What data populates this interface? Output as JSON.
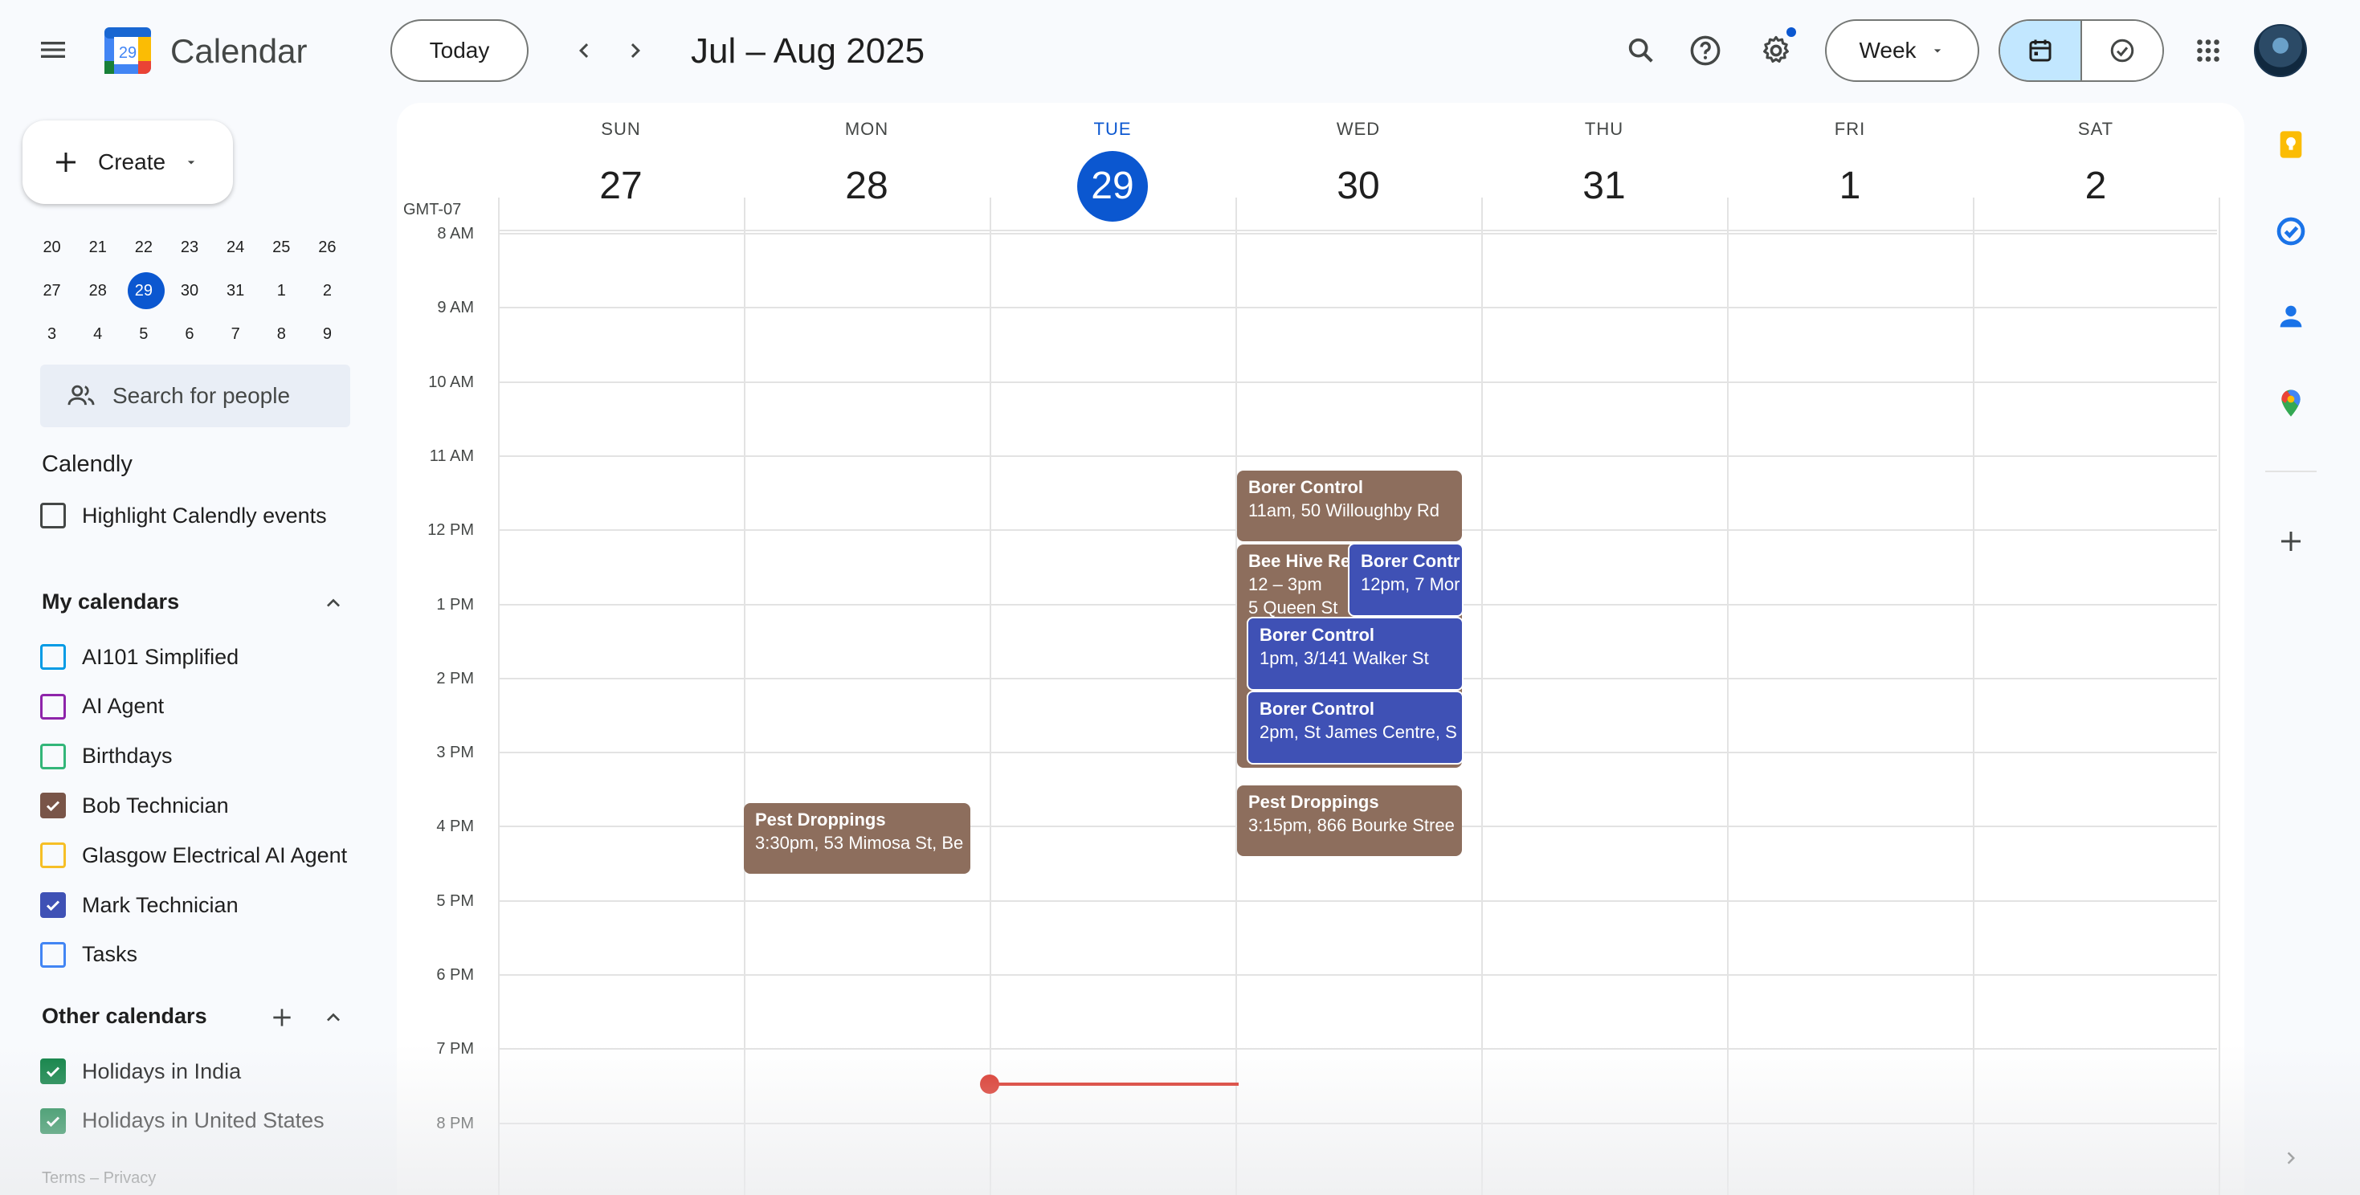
{
  "header": {
    "app_title": "Calendar",
    "logo_day": "29",
    "today_label": "Today",
    "range_title": "Jul – Aug 2025",
    "view_label": "Week"
  },
  "sidebar": {
    "create_label": "Create",
    "mini_calendar": {
      "rows": [
        [
          "20",
          "21",
          "22",
          "23",
          "24",
          "25",
          "26"
        ],
        [
          "27",
          "28",
          "29",
          "30",
          "31",
          "1",
          "2"
        ],
        [
          "3",
          "4",
          "5",
          "6",
          "7",
          "8",
          "9"
        ]
      ],
      "today": "29"
    },
    "people_search_placeholder": "Search for people",
    "calendly": {
      "title": "Calendly",
      "highlight_label": "Highlight Calendly events"
    },
    "my_calendars": {
      "title": "My calendars",
      "items": [
        {
          "label": "AI101 Simplified",
          "color": "#039be5",
          "checked": false
        },
        {
          "label": "AI Agent",
          "color": "#8e24aa",
          "checked": false
        },
        {
          "label": "Birthdays",
          "color": "#33b679",
          "checked": false
        },
        {
          "label": "Bob Technician",
          "color": "#795548",
          "checked": true
        },
        {
          "label": "Glasgow Electrical AI Agent",
          "color": "#f6bf26",
          "checked": false
        },
        {
          "label": "Mark Technician",
          "color": "#3f51b5",
          "checked": true
        },
        {
          "label": "Tasks",
          "color": "#4285f4",
          "checked": false
        }
      ]
    },
    "other_calendars": {
      "title": "Other calendars",
      "items": [
        {
          "label": "Holidays in India",
          "color": "#0b8043",
          "checked": true
        },
        {
          "label": "Holidays in United States",
          "color": "#0b8043",
          "checked": true
        }
      ]
    },
    "footer": "Terms – Privacy"
  },
  "week": {
    "timezone": "GMT-07",
    "days": [
      {
        "name": "SUN",
        "num": "27",
        "today": false
      },
      {
        "name": "MON",
        "num": "28",
        "today": false
      },
      {
        "name": "TUE",
        "num": "29",
        "today": true
      },
      {
        "name": "WED",
        "num": "30",
        "today": false
      },
      {
        "name": "THU",
        "num": "31",
        "today": false
      },
      {
        "name": "FRI",
        "num": "1",
        "today": false
      },
      {
        "name": "SAT",
        "num": "2",
        "today": false
      }
    ],
    "hours": [
      "8 AM",
      "9 AM",
      "10 AM",
      "11 AM",
      "12 PM",
      "1 PM",
      "2 PM",
      "3 PM",
      "4 PM",
      "5 PM",
      "6 PM",
      "7 PM",
      "8 PM"
    ]
  },
  "events": [
    {
      "title": "Borer Control",
      "detail": "11am, 50 Willoughby Rd",
      "extra": ""
    },
    {
      "title": "Bee Hive Re",
      "detail": "12 – 3pm",
      "extra": "5 Queen St"
    },
    {
      "title": "Borer Contr",
      "detail": "12pm, 7 Mor",
      "extra": ""
    },
    {
      "title": "Borer Control",
      "detail": "1pm, 3/141 Walker St",
      "extra": ""
    },
    {
      "title": "Borer Control",
      "detail": "2pm, St James Centre, S",
      "extra": ""
    },
    {
      "title": "Pest Droppings",
      "detail": "3:15pm, 866 Bourke Stree",
      "extra": ""
    },
    {
      "title": "Pest Droppings",
      "detail": "3:30pm, 53 Mimosa St, Be",
      "extra": ""
    }
  ],
  "colors": {
    "accent": "#0b57d0",
    "event_brown": "#8d6e5d",
    "event_blue": "#3f51b5",
    "now_line": "#d93025"
  }
}
